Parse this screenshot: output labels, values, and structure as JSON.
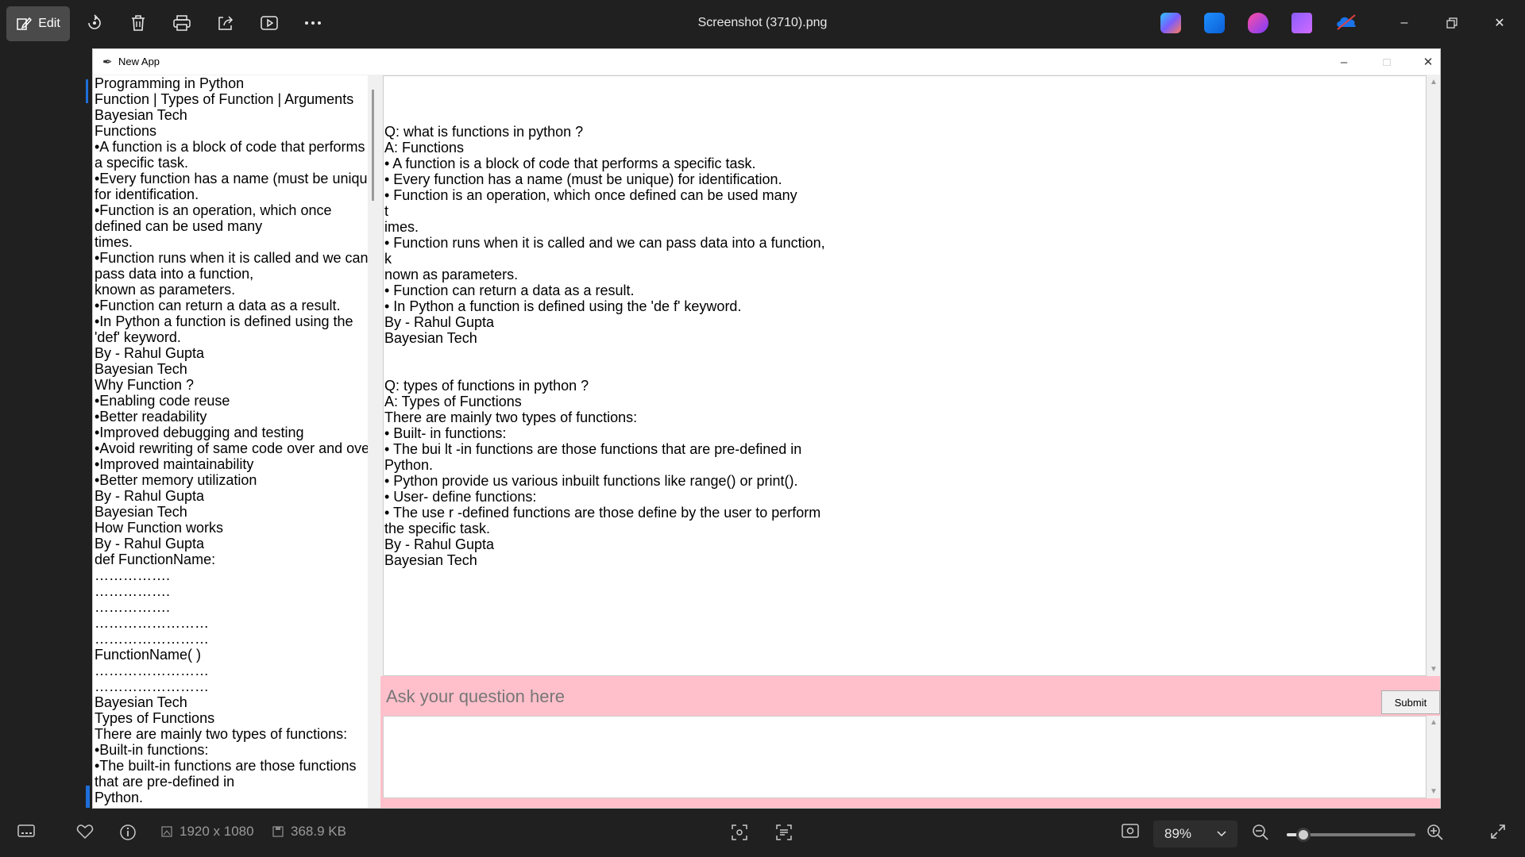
{
  "toolbar": {
    "edit_label": "Edit",
    "title": "Screenshot (3710).png"
  },
  "app": {
    "title": "New App",
    "left_lines": [
      "Programming in Python",
      "Function | Types of Function | Arguments",
      "Bayesian Tech",
      "Functions",
      "•A function is a block of code that performs",
      "a specific task.",
      "•Every function has a name (must be unique)",
      "for identification.",
      "•Function is an operation, which once",
      "defined can be used many",
      "times.",
      "•Function runs when it is called and we can",
      "pass data into a function,",
      "known as parameters.",
      "•Function can return a data as a result.",
      "•In Python a function is defined using the",
      "'def' keyword.",
      "By - Rahul Gupta",
      "Bayesian Tech",
      "Why Function ?",
      "•Enabling code reuse",
      "•Better readability",
      "•Improved debugging and testing",
      "•Avoid rewriting of same code over and over",
      "•Improved maintainability",
      "•Better memory utilization",
      "By - Rahul Gupta",
      "Bayesian Tech",
      "How Function works",
      "By - Rahul Gupta",
      "def FunctionName:",
      "…………….",
      "…………….",
      "…………….",
      "……………………",
      "……………………",
      "FunctionName( )",
      "……………………",
      "……………………",
      "Bayesian Tech",
      "Types of Functions",
      "There are mainly two types of functions:",
      "•Built-in functions:",
      "•The built-in functions are those functions",
      "that are pre-defined in",
      "Python."
    ],
    "main_lines": [
      "",
      "",
      "",
      "Q: what is functions in python ?",
      "A: Functions",
      "• A function is a block of code that performs a specific task.",
      "• Every function has a name (must be unique) for identification.",
      "• Function is an operation, which once defined can be used many",
      "t",
      "imes.",
      "• Function runs when it is called and we can pass data into a function,",
      "k",
      "nown as parameters.",
      "• Function can return a data as a result.",
      "• In Python a function is defined using the 'de f' keyword.",
      "By - Rahul Gupta",
      "Bayesian Tech",
      "",
      "",
      "Q: types of functions in python ?",
      "A: Types of Functions",
      "There are mainly two types of functions:",
      "• Built- in functions:",
      "• The bui lt -in functions are those functions that are pre-defined in",
      "Python.",
      "• Python provide us various inbuilt functions like range() or print().",
      "• User- define functions:",
      "• The use r -defined functions are those define by the user to perform",
      "the specific task.",
      "By - Rahul Gupta",
      "Bayesian Tech"
    ],
    "question_placeholder": "Ask your question here",
    "submit_label": "Submit"
  },
  "bottombar": {
    "dimensions": "1920 x 1080",
    "file_size": "368.9 KB",
    "zoom": "89%",
    "zoom_fraction": 0.13
  },
  "colors": {
    "pink": "#ffc0cb",
    "toolbar_bg": "#202020"
  }
}
